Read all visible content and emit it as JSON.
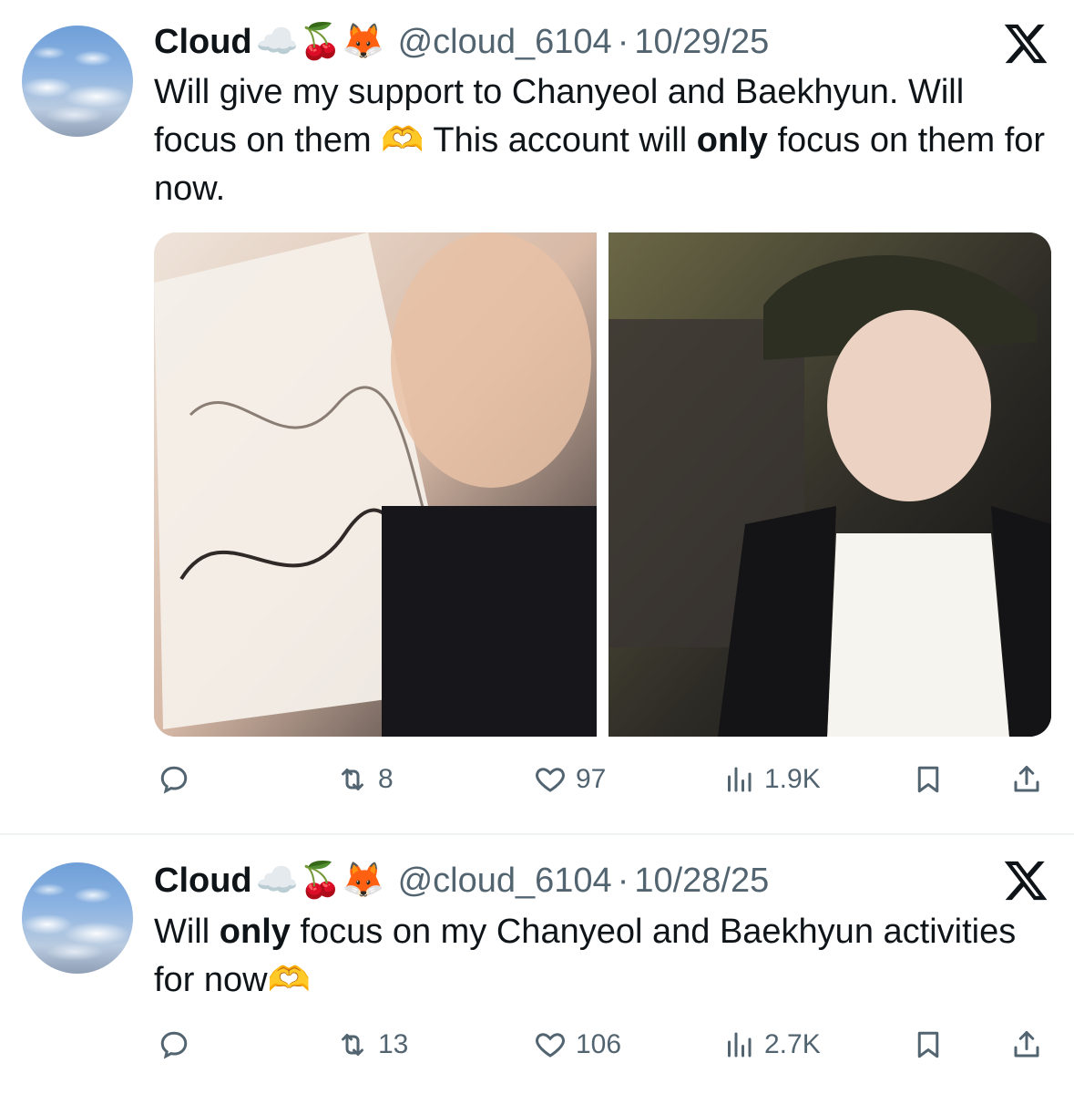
{
  "tweets": [
    {
      "name": "Cloud",
      "emojis": "☁️🍒🦊",
      "handle": "@cloud_6104",
      "separator": "·",
      "date": "10/29/25",
      "text": {
        "part1": "Will give my support to Chanyeol and Baekhyun. Will focus on them 🫶 This account will ",
        "bold": "only",
        "part2": " focus on them for now."
      },
      "media": [
        {
          "icon": "photo-selfie-with-signed-album"
        },
        {
          "icon": "photo-selfie-with-cap"
        }
      ],
      "actions": {
        "reply": "",
        "retweets": "8",
        "likes": "97",
        "views": "1.9K"
      }
    },
    {
      "name": "Cloud",
      "emojis": "☁️🍒🦊",
      "handle": "@cloud_6104",
      "separator": "·",
      "date": "10/28/25",
      "text": {
        "part1": "Will ",
        "bold": "only",
        "part2": " focus on my Chanyeol and Baekhyun activities for now🫶"
      },
      "actions": {
        "reply": "",
        "retweets": "13",
        "likes": "106",
        "views": "2.7K"
      }
    }
  ],
  "icons": {
    "reply": "reply-icon",
    "retweet": "retweet-icon",
    "like": "heart-icon",
    "views": "views-icon",
    "bookmark": "bookmark-icon",
    "share": "share-icon",
    "platform": "x-logo-icon"
  },
  "colors": {
    "text": "#0f1419",
    "muted": "#536471",
    "divider": "#eff3f4"
  }
}
